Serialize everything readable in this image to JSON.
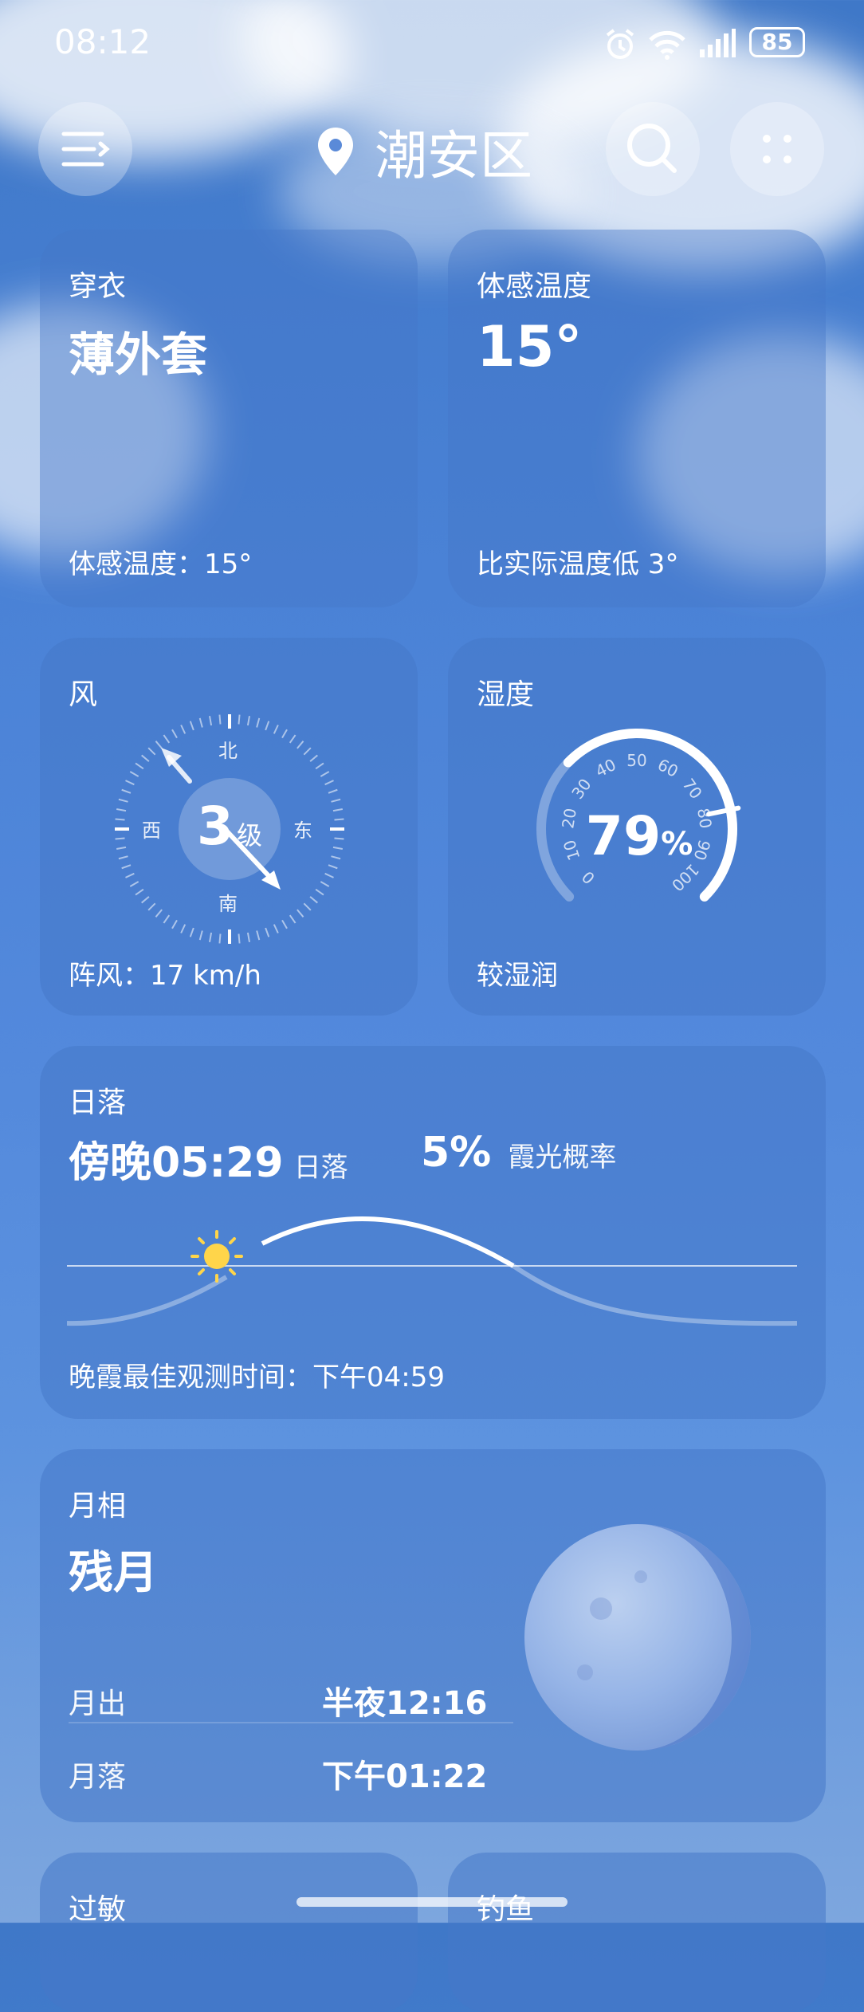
{
  "status": {
    "time": "08:12",
    "battery": "85"
  },
  "header": {
    "location": "潮安区",
    "menu_icon": "menu-icon",
    "search_icon": "search-icon",
    "more_icon": "more-icon"
  },
  "clothing": {
    "title": "穿衣",
    "value": "薄外套",
    "note": "体感温度：15°"
  },
  "feels": {
    "title": "体感温度",
    "value": "15°",
    "note": "比实际温度低 3°"
  },
  "wind": {
    "title": "风",
    "level": "3",
    "unit": "级",
    "n": "北",
    "s": "南",
    "e": "东",
    "w": "西",
    "gust": "阵风：17 km/h"
  },
  "humidity": {
    "title": "湿度",
    "value": "79",
    "unit": "%",
    "level": 0.79,
    "note": "较湿润",
    "ticks": [
      "0",
      "10",
      "20",
      "30",
      "40",
      "50",
      "60",
      "70",
      "80",
      "90",
      "100"
    ]
  },
  "sunset": {
    "title": "日落",
    "time": "傍晚05:29",
    "time_label": "日落",
    "prob": "5%",
    "prob_label": "霞光概率",
    "best": "晚霞最佳观测时间：下午04:59"
  },
  "moon": {
    "title": "月相",
    "phase": "残月",
    "rise_label": "月出",
    "rise_time": "半夜12:16",
    "set_label": "月落",
    "set_time": "下午01:22"
  },
  "bottom": {
    "left_title": "过敏",
    "right_title": "钓鱼"
  }
}
